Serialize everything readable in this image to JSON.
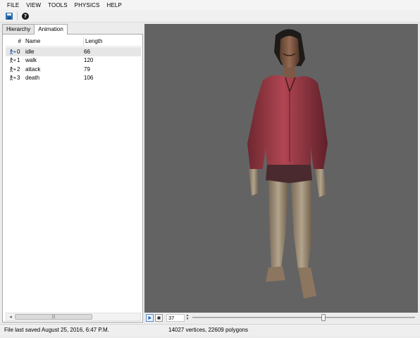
{
  "menu": [
    "FILE",
    "VIEW",
    "TOOLS",
    "PHYSICS",
    "HELP"
  ],
  "toolbar": {
    "save_icon": "save-icon",
    "help_icon": "help-icon",
    "help_glyph": "?"
  },
  "tabs": [
    {
      "label": "Hierarchy",
      "active": false
    },
    {
      "label": "Animation",
      "active": true
    }
  ],
  "animation_table": {
    "columns": [
      "#",
      "Name",
      "Length"
    ],
    "rows": [
      {
        "num": "0",
        "name": "idle",
        "length": "66",
        "icon": "animation-icon",
        "selected": true
      },
      {
        "num": "1",
        "name": "walk",
        "length": "120",
        "icon": "animation-icon",
        "selected": false
      },
      {
        "num": "2",
        "name": "attack",
        "length": "79",
        "icon": "animation-icon",
        "selected": false
      },
      {
        "num": "3",
        "name": "death",
        "length": "106",
        "icon": "animation-icon",
        "selected": false
      }
    ]
  },
  "scrollbar": {
    "left_arrow": "◂",
    "thumb_grip": "|||"
  },
  "playback": {
    "play_icon": "play-icon",
    "stop_icon": "stop-icon",
    "frame_value": "37",
    "timeline_progress": 0.59
  },
  "status": {
    "left": "File last saved August 25, 2016, 6:47 P.M.",
    "center": "14027 vertices, 22609 polygons"
  },
  "colors": {
    "viewport_bg": "#636363",
    "accent": "#2a6fb5",
    "shirt": "#9b3f4a"
  }
}
